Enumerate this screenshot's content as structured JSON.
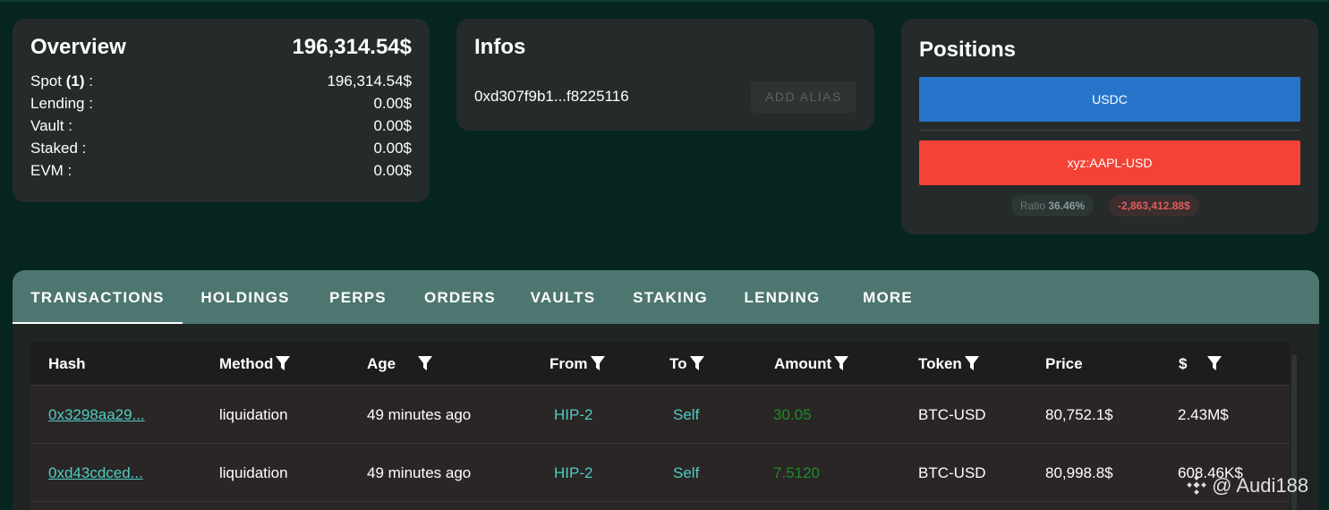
{
  "overview": {
    "title": "Overview",
    "total": "196,314.54$",
    "rows": [
      {
        "label": "Spot ",
        "count": "(1)",
        "suffix": " :",
        "value": "196,314.54$"
      },
      {
        "label": "Lending :",
        "count": "",
        "suffix": "",
        "value": "0.00$"
      },
      {
        "label": "Vault :",
        "count": "",
        "suffix": "",
        "value": "0.00$"
      },
      {
        "label": "Staked :",
        "count": "",
        "suffix": "",
        "value": "0.00$"
      },
      {
        "label": "EVM :",
        "count": "",
        "suffix": "",
        "value": "0.00$"
      }
    ]
  },
  "infos": {
    "title": "Infos",
    "address": "0xd307f9b1...f8225116",
    "add_alias_label": "ADD ALIAS"
  },
  "positions": {
    "title": "Positions",
    "long_label": "USDC",
    "short_label": "xyz:AAPL-USD",
    "ratio_label": "Ratio",
    "ratio_value": "36.46%",
    "pnl": "-2,863,412.88$",
    "colors": {
      "long": "#2775ca",
      "short": "#f44336"
    }
  },
  "tabs": [
    {
      "label": "TRANSACTIONS",
      "active": true
    },
    {
      "label": "HOLDINGS",
      "active": false
    },
    {
      "label": "PERPS",
      "active": false
    },
    {
      "label": "ORDERS",
      "active": false
    },
    {
      "label": "VAULTS",
      "active": false
    },
    {
      "label": "STAKING",
      "active": false
    },
    {
      "label": "LENDING",
      "active": false
    },
    {
      "label": "MORE",
      "active": false
    }
  ],
  "table": {
    "headers": {
      "hash": "Hash",
      "method": "Method",
      "age": "Age",
      "from": "From",
      "to": "To",
      "amount": "Amount",
      "token": "Token",
      "price": "Price",
      "usd": "$"
    },
    "rows": [
      {
        "hash": "0x3298aa29...",
        "method": "liquidation",
        "age": "49 minutes ago",
        "from": "HIP-2",
        "to": "Self",
        "amount": "30.05",
        "token": "BTC-USD",
        "price": "80,752.1$",
        "usd": "2.43M$"
      },
      {
        "hash": "0xd43cdced...",
        "method": "liquidation",
        "age": "49 minutes ago",
        "from": "HIP-2",
        "to": "Self",
        "amount": "7.5120",
        "token": "BTC-USD",
        "price": "80,998.8$",
        "usd": "608.46K$"
      }
    ]
  },
  "watermark": {
    "text": "@ Audi188",
    "icon": "binance-logo-icon"
  }
}
